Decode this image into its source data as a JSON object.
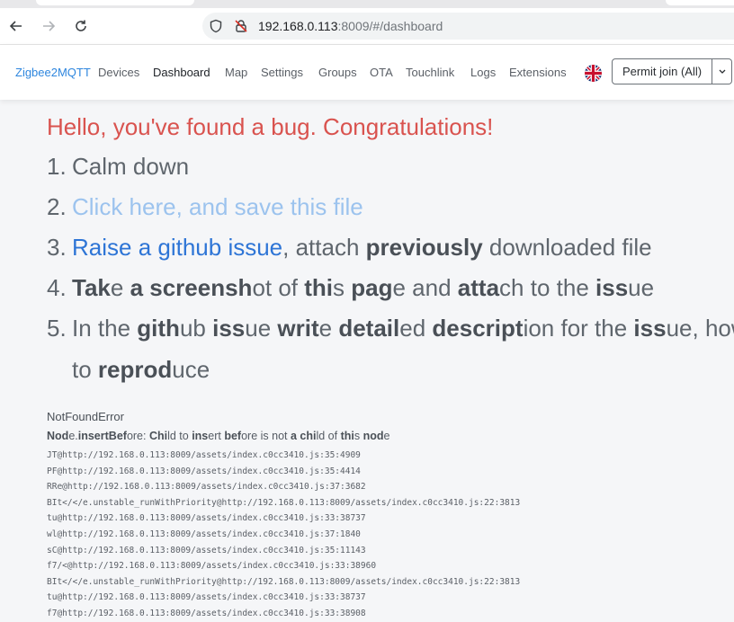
{
  "browser": {
    "url_host": "192.168.0.113",
    "url_rest": ":8009/#/dashboard"
  },
  "nav": {
    "brand": "Zigbee2MQTT",
    "items": [
      "Devices",
      "Dashboard",
      "Map",
      "Settings",
      "Groups",
      "OTA",
      "Touchlink",
      "Logs",
      "Extensions"
    ],
    "active": "Dashboard",
    "permit_join": "Permit join (All)"
  },
  "error_page": {
    "title": "Hello, you've found a bug. Congratulations!",
    "steps": [
      {
        "num": "1.",
        "text": "Calm down"
      },
      {
        "num": "2.",
        "link": "Click here, and save this file"
      },
      {
        "num": "3.",
        "link": "Raise a github issue",
        "after": ", attach ",
        "bold": "previously",
        "tail": " downloaded file"
      },
      {
        "num": "4.",
        "text": "Take a screenshot of this page and attach to the issue"
      },
      {
        "num": "5.",
        "text": "In the github issue write detailed description for the issue, how",
        "cont": "to reproduce"
      }
    ],
    "error_name": "NotFoundError",
    "error_message": "Node.insertBefore: Child to insert before is not a child of this node",
    "stack": [
      "JT@http://192.168.0.113:8009/assets/index.c0cc3410.js:35:4909",
      "PF@http://192.168.0.113:8009/assets/index.c0cc3410.js:35:4414",
      "RRe@http://192.168.0.113:8009/assets/index.c0cc3410.js:37:3682",
      "BIt</</e.unstable_runWithPriority@http://192.168.0.113:8009/assets/index.c0cc3410.js:22:3813",
      "tu@http://192.168.0.113:8009/assets/index.c0cc3410.js:33:38737",
      "wl@http://192.168.0.113:8009/assets/index.c0cc3410.js:37:1840",
      "sC@http://192.168.0.113:8009/assets/index.c0cc3410.js:35:11143",
      "f7/<@http://192.168.0.113:8009/assets/index.c0cc3410.js:33:38960",
      "BIt</</e.unstable_runWithPriority@http://192.168.0.113:8009/assets/index.c0cc3410.js:22:3813",
      "tu@http://192.168.0.113:8009/assets/index.c0cc3410.js:33:38737",
      "f7@http://192.168.0.113:8009/assets/index.c0cc3410.js:33:38908"
    ]
  }
}
